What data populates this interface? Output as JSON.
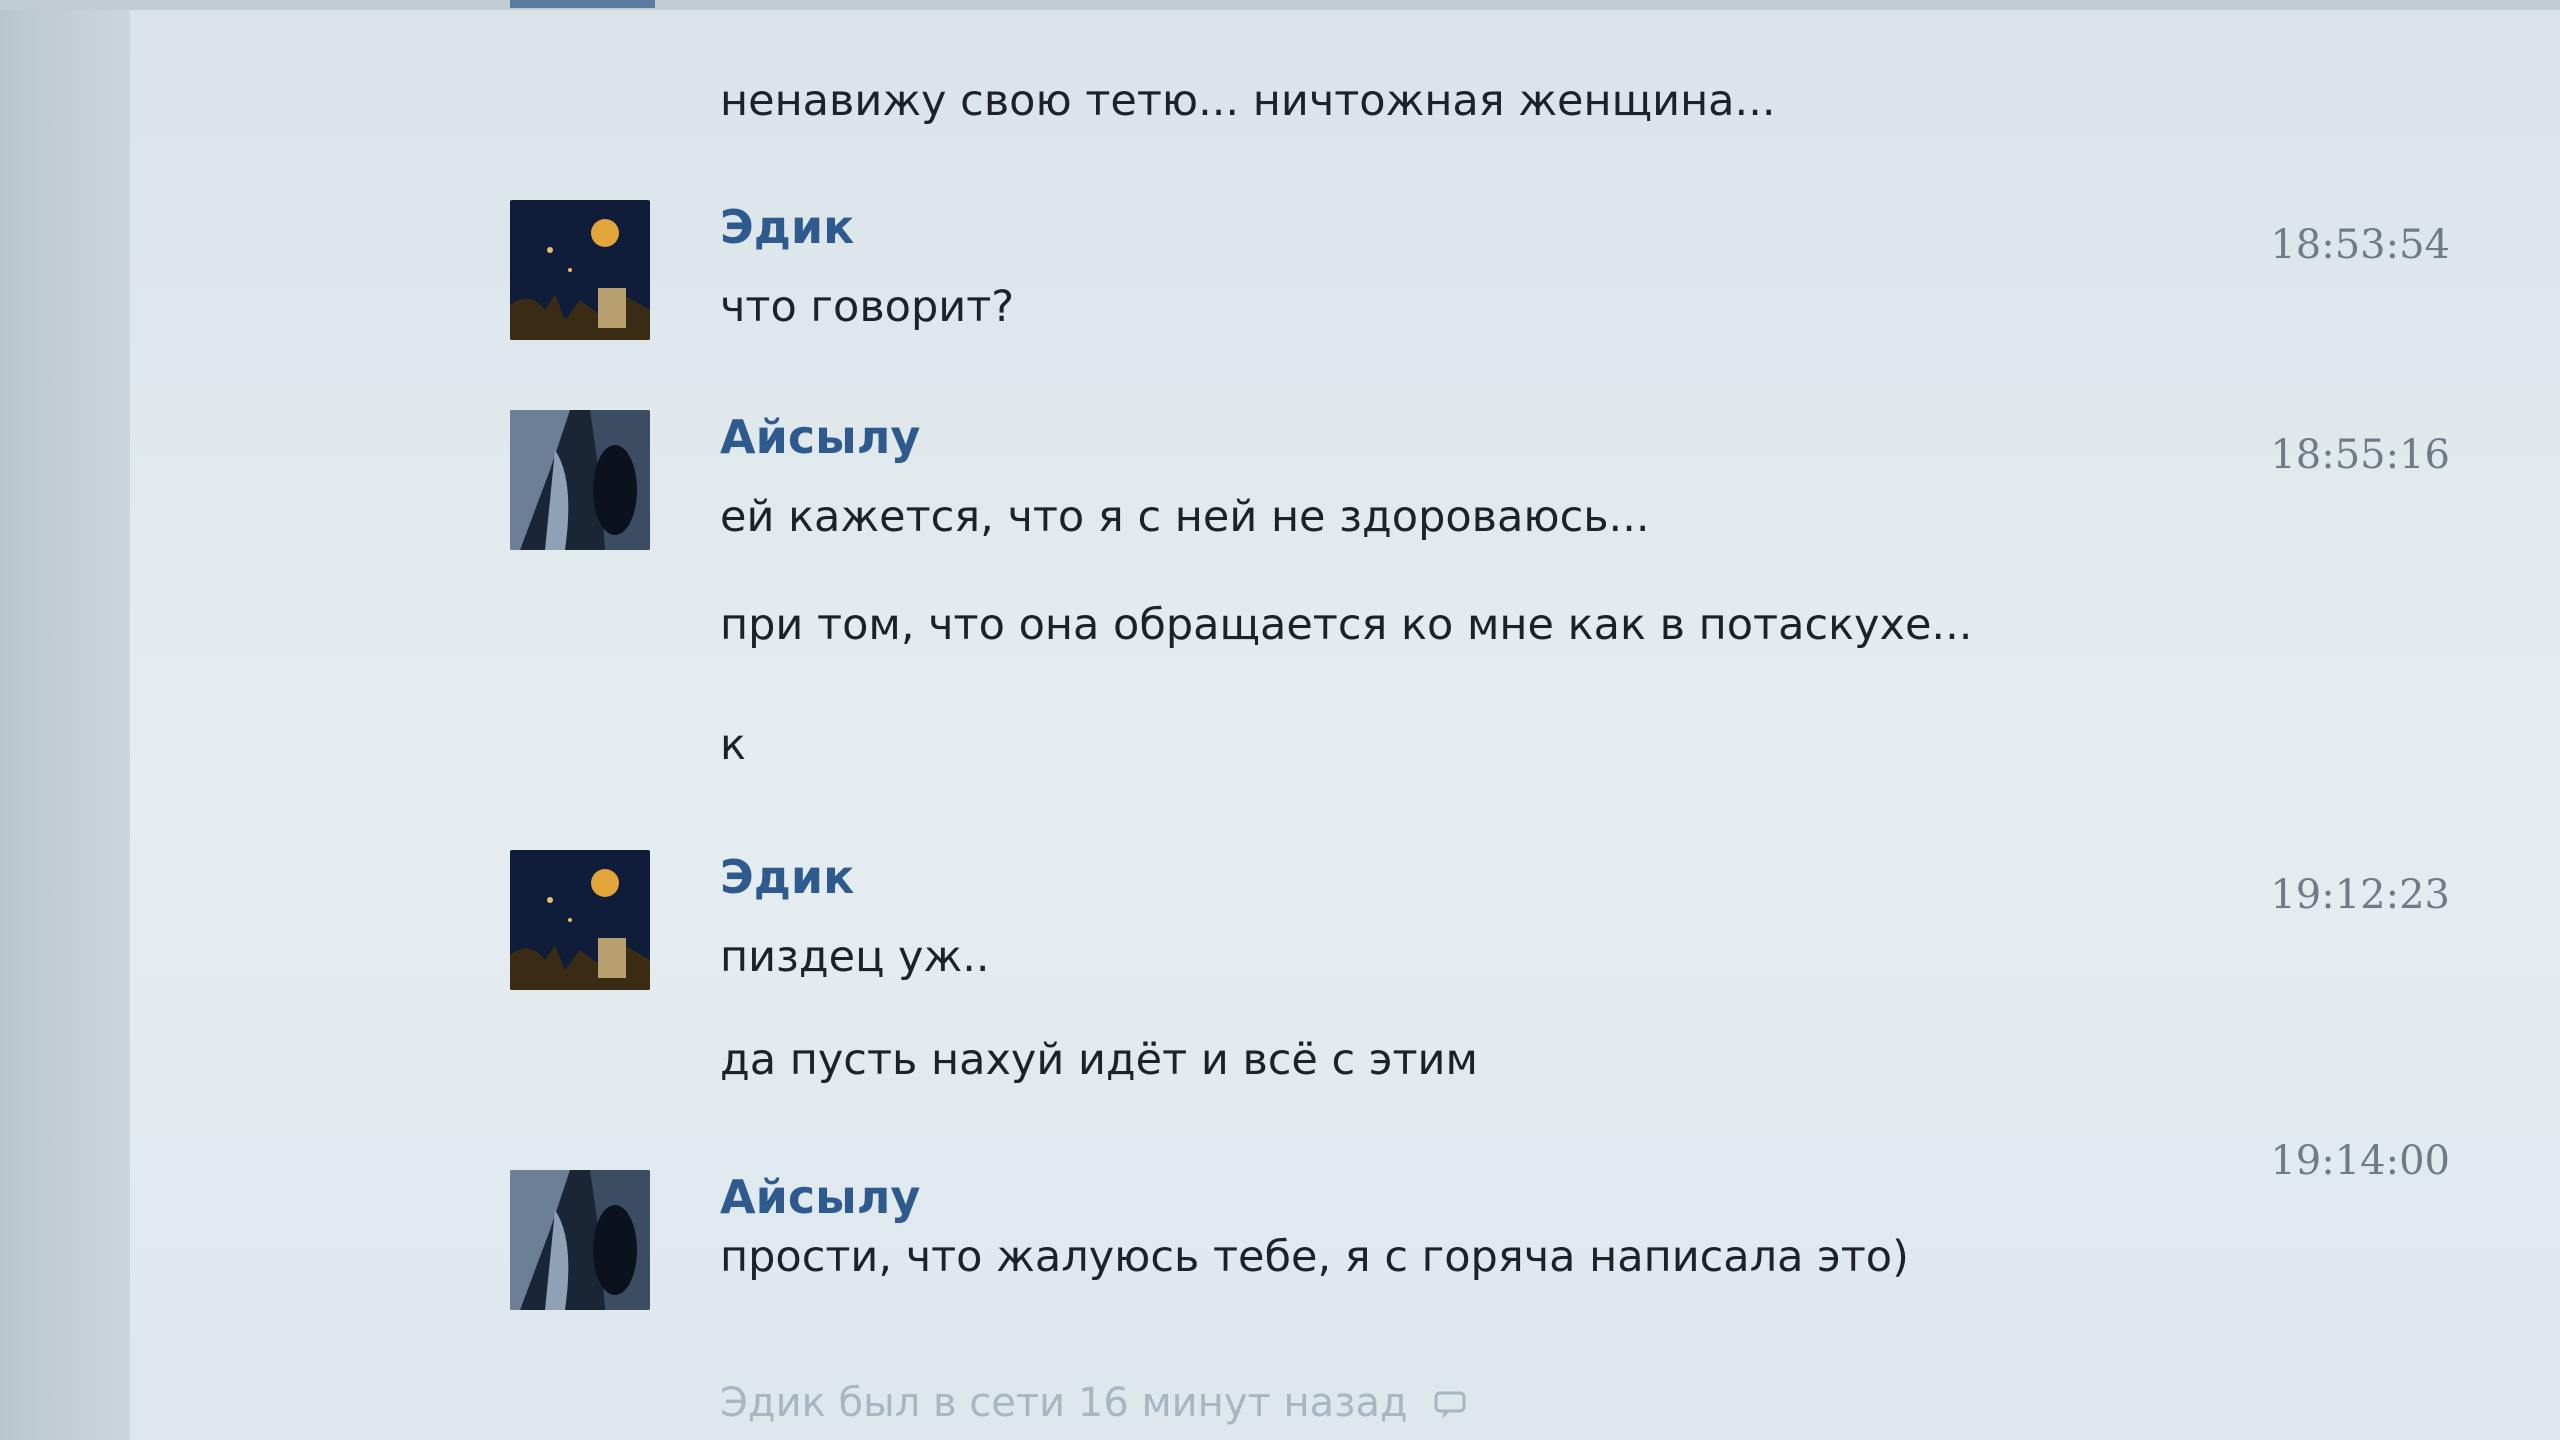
{
  "messages": [
    {
      "text": "ненавижу свою тетю... ничтожная женщина..."
    },
    {
      "author": "Эдик",
      "time": "18:53:54",
      "lines": [
        "что говорит?"
      ]
    },
    {
      "author": "Айсылу",
      "time": "18:55:16",
      "lines": [
        "ей кажется, что я с ней не здороваюсь...",
        "при том, что она обращается ко мне как в потаскухе...",
        "к"
      ]
    },
    {
      "author": "Эдик",
      "time": "19:12:23",
      "lines": [
        "пиздец уж..",
        "да пусть нахуй идёт и всё с этим"
      ]
    },
    {
      "author": "Айсылу",
      "time": "19:14:00",
      "lines": [
        "прости, что жалуюсь тебе, я с горяча написала это)"
      ]
    }
  ],
  "status": {
    "text": "Эдик был в сети 16 минут назад"
  },
  "icons": {
    "avatar_edik": "avatar-night-sky-icon",
    "avatar_aisylu": "avatar-photo-icon",
    "status": "chat-bubble-icon"
  },
  "colors": {
    "author": "#2e5a8e",
    "time": "#6f7c86",
    "text": "#1c2228",
    "status": "#a7b6c1",
    "background": "#e6edf0"
  }
}
